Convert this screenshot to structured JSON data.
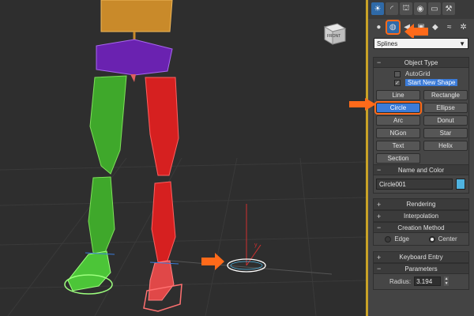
{
  "viewport": {
    "viewcube_label": "FRONT"
  },
  "command_panel": {
    "tabs": [
      {
        "name": "create-tab",
        "glyph": "☀",
        "active": true
      },
      {
        "name": "modify-tab",
        "glyph": "◜",
        "active": false
      },
      {
        "name": "hierarchy-tab",
        "glyph": "⛫",
        "active": false
      },
      {
        "name": "motion-tab",
        "glyph": "◉",
        "active": false
      },
      {
        "name": "display-tab",
        "glyph": "▭",
        "active": false
      },
      {
        "name": "utilities-tab",
        "glyph": "⚒",
        "active": false
      }
    ],
    "categories": [
      {
        "name": "geometry",
        "glyph": "●"
      },
      {
        "name": "shapes",
        "glyph": "◍"
      },
      {
        "name": "lights",
        "glyph": "◀"
      },
      {
        "name": "cameras",
        "glyph": "▣"
      },
      {
        "name": "helpers",
        "glyph": "◆"
      },
      {
        "name": "spacewarps",
        "glyph": "≈"
      },
      {
        "name": "systems",
        "glyph": "✲"
      }
    ],
    "dropdown_value": "Splines",
    "object_type": {
      "title": "Object Type",
      "autogrid_label": "AutoGrid",
      "start_new_shape_label": "Start New Shape",
      "buttons": [
        "Line",
        "Rectangle",
        "Circle",
        "Ellipse",
        "Arc",
        "Donut",
        "NGon",
        "Star",
        "Text",
        "Helix",
        "Section"
      ],
      "active_button": "Circle"
    },
    "name_and_color": {
      "title": "Name and Color",
      "name_value": "Circle001",
      "color": "#4fb3e0"
    },
    "rendering": {
      "title": "Rendering"
    },
    "interpolation": {
      "title": "Interpolation"
    },
    "creation_method": {
      "title": "Creation Method",
      "options": [
        "Edge",
        "Center"
      ],
      "selected": "Center"
    },
    "keyboard_entry": {
      "title": "Keyboard Entry"
    },
    "parameters": {
      "title": "Parameters",
      "radius_label": "Radius:",
      "radius_value": "3.194"
    },
    "rollout_signs": {
      "expanded": "−",
      "collapsed": "+"
    }
  },
  "colors": {
    "accent_orange": "#ff6a1a",
    "selection_blue": "#3b7bd8",
    "divider_gold": "#c9a227",
    "left_leg": "#3fa82b",
    "right_leg": "#d62020",
    "pelvis": "#6a22b0",
    "torso": "#c98a2a"
  }
}
